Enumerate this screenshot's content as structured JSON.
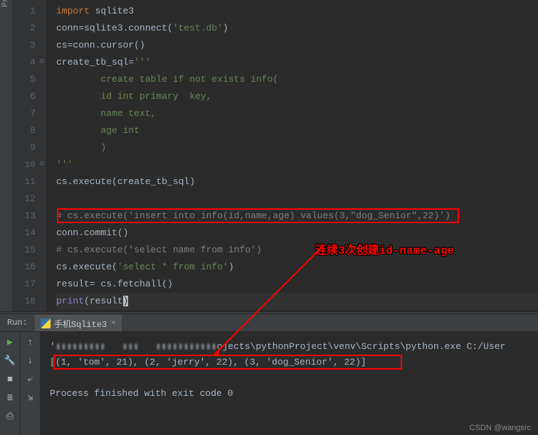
{
  "left_tab": "Proj",
  "gutter_lines": [
    "1",
    "2",
    "3",
    "4",
    "5",
    "6",
    "7",
    "8",
    "9",
    "10",
    "11",
    "12",
    "13",
    "14",
    "15",
    "16",
    "17",
    "18"
  ],
  "code": {
    "l1_import": "import",
    "l1_mod": " sqlite3",
    "l2_a": "conn=sqlite3.connect(",
    "l2_str": "'test.db'",
    "l2_b": ")",
    "l3": "cs=conn.cursor()",
    "l4_a": "create_tb_sql=",
    "l4_str": "'''",
    "l5_str": "        create table if not exists info(",
    "l6_str": "        id int primary  key,",
    "l7_str": "        name text,",
    "l8_str": "        age int",
    "l9_str": "        )",
    "l10_str": "'''",
    "l11": "cs.execute(create_tb_sql)",
    "l12": "",
    "l13_comment": "# cs.execute('insert into info(id,name,age) values(3,\"dog_Senior\",22)')",
    "l14": "conn.commit()",
    "l15_comment": "# cs.execute('select name from info')",
    "l16_a": "cs.execute(",
    "l16_str": "'select * from info'",
    "l16_b": ")",
    "l17": "result= cs.fetchall()",
    "l18_print": "print",
    "l18_a": "(result",
    "l18_b": ")"
  },
  "annotation": "连续3次创建id-name-age",
  "run": {
    "label": "Run:",
    "tab_name": "手机Sqlite3",
    "out_line1_a": "'",
    "out_line1_b": "ojects\\pythonProject\\venv\\Scripts\\python.exe C:/User",
    "out_line2": "[(1, 'tom', 21), (2, 'jerry', 22), (3, 'dog_Senior', 22)]",
    "out_line4": "Process finished with exit code 0"
  },
  "watermark": "CSDN @wangsrc"
}
